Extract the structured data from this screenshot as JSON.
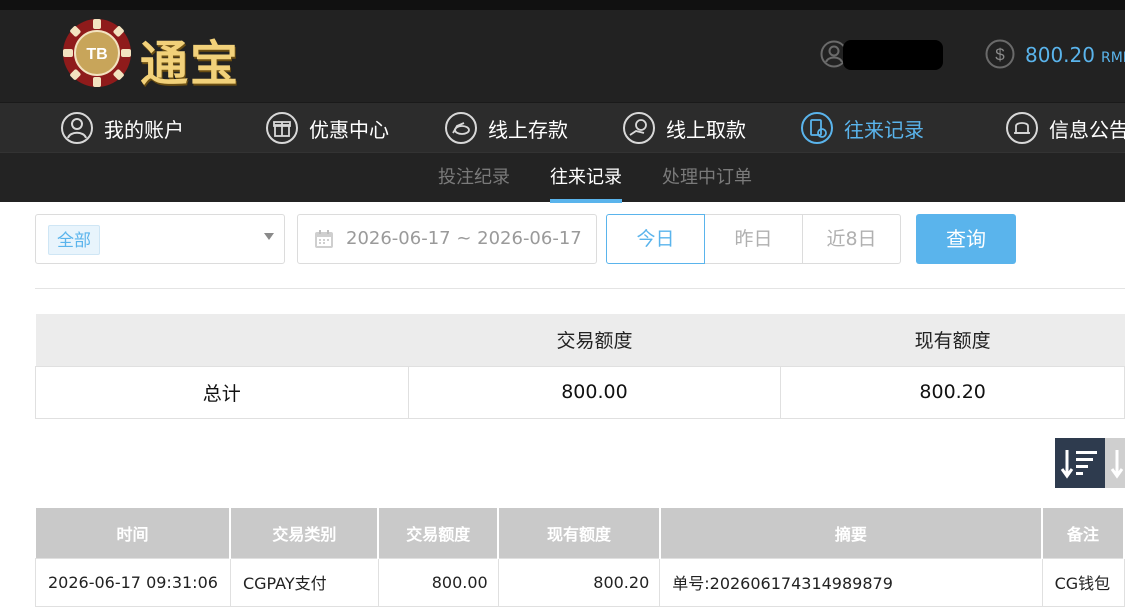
{
  "header": {
    "logo_text": "TB",
    "brand": "通宝",
    "balance": "800.20",
    "currency": "RMB"
  },
  "nav": [
    {
      "label": "我的账户",
      "icon": "user-icon"
    },
    {
      "label": "优惠中心",
      "icon": "gift-icon"
    },
    {
      "label": "线上存款",
      "icon": "deposit-icon"
    },
    {
      "label": "线上取款",
      "icon": "withdraw-icon"
    },
    {
      "label": "往来记录",
      "icon": "records-icon",
      "active": true
    },
    {
      "label": "信息公告",
      "icon": "bell-icon"
    }
  ],
  "subnav": [
    {
      "label": "投注纪录"
    },
    {
      "label": "往来记录",
      "active": true
    },
    {
      "label": "处理中订单"
    }
  ],
  "filters": {
    "type_tag": "全部",
    "date_range": "2026-06-17 ~ 2026-06-17",
    "quick": [
      "今日",
      "昨日",
      "近8日"
    ],
    "query_label": "查询"
  },
  "summary": {
    "headers": [
      "",
      "交易额度",
      "现有额度"
    ],
    "row": [
      "总计",
      "800.00",
      "800.20"
    ]
  },
  "records": {
    "headers": [
      "时间",
      "交易类别",
      "交易额度",
      "现有额度",
      "摘要",
      "备注"
    ],
    "rows": [
      [
        "2026-06-17 09:31:06",
        "CGPAY支付",
        "800.00",
        "800.20",
        "单号:202606174314989879",
        "CG钱包"
      ]
    ]
  },
  "colors": {
    "accent": "#5ab4ec",
    "header_bg": "#222222",
    "nav_bg": "#2c2c2c",
    "brand_gold": "#f2d17a"
  }
}
